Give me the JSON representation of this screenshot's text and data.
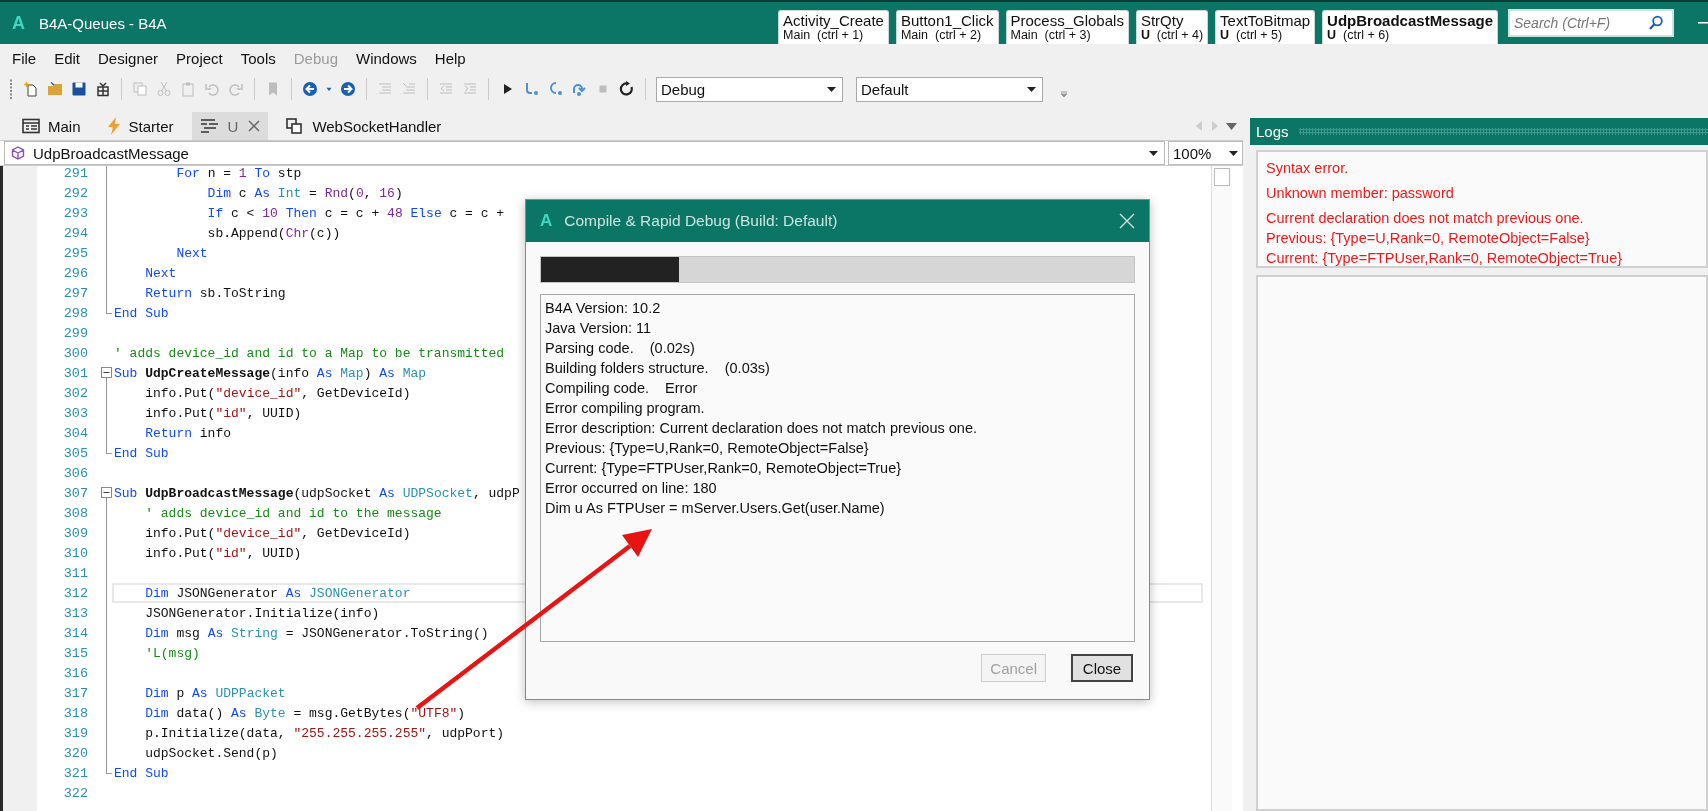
{
  "window": {
    "logo": "A",
    "title": "B4A-Queues - B4A"
  },
  "quick_tabs": [
    {
      "label": "Activity_Create",
      "sub": "Main  (ctrl + 1)",
      "selected": false
    },
    {
      "label": "Button1_Click",
      "sub": "Main  (ctrl + 2)",
      "selected": false
    },
    {
      "label": "Process_Globals",
      "sub": "Main  (ctrl + 3)",
      "selected": false
    },
    {
      "label": "StrQty",
      "sub": "**U**  (ctrl + 4)",
      "selected": false
    },
    {
      "label": "TextToBitmap",
      "sub": "**U**  (ctrl + 5)",
      "selected": false
    },
    {
      "label": "UdpBroadcastMessage",
      "sub": "**U**  (ctrl + 6)",
      "selected": true
    }
  ],
  "search": {
    "placeholder": "Search (Ctrl+F)"
  },
  "menu": [
    {
      "label": "File",
      "disabled": false
    },
    {
      "label": "Edit",
      "disabled": false
    },
    {
      "label": "Designer",
      "disabled": false
    },
    {
      "label": "Project",
      "disabled": false
    },
    {
      "label": "Tools",
      "disabled": false
    },
    {
      "label": "Debug",
      "disabled": true
    },
    {
      "label": "Windows",
      "disabled": false
    },
    {
      "label": "Help",
      "disabled": false
    }
  ],
  "toolbar_groups": [
    [
      {
        "kind": "new",
        "disabled": false
      },
      {
        "kind": "open",
        "disabled": false
      },
      {
        "kind": "save",
        "disabled": false
      },
      {
        "kind": "package",
        "disabled": false
      }
    ],
    [
      {
        "kind": "copy",
        "disabled": true
      },
      {
        "kind": "cut",
        "disabled": true
      },
      {
        "kind": "paste",
        "disabled": true
      },
      {
        "kind": "undo",
        "disabled": true
      },
      {
        "kind": "redo",
        "disabled": true
      }
    ],
    [
      {
        "kind": "bookmark",
        "disabled": true
      }
    ],
    [
      {
        "kind": "back",
        "disabled": false
      },
      {
        "kind": "caret",
        "disabled": false
      },
      {
        "kind": "forward",
        "disabled": false
      }
    ],
    [
      {
        "kind": "comment",
        "disabled": true
      },
      {
        "kind": "uncomment",
        "disabled": true
      }
    ],
    [
      {
        "kind": "outdent",
        "disabled": true
      },
      {
        "kind": "indent",
        "disabled": true
      }
    ],
    [
      {
        "kind": "run",
        "disabled": false
      },
      {
        "kind": "stepin",
        "disabled": false
      },
      {
        "kind": "stepover",
        "disabled": false
      },
      {
        "kind": "stepout",
        "disabled": false
      },
      {
        "kind": "stop",
        "disabled": true
      },
      {
        "kind": "restart",
        "disabled": false
      }
    ]
  ],
  "build_dropdowns": [
    {
      "value": "Debug"
    },
    {
      "value": "Default"
    }
  ],
  "doc_tabs": [
    {
      "label": "Main",
      "kind": "main",
      "selected": false
    },
    {
      "label": "Starter",
      "kind": "starter",
      "selected": false
    },
    {
      "label": "U",
      "kind": "code",
      "selected": true
    },
    {
      "label": "WebSocketHandler",
      "kind": "class",
      "selected": false
    }
  ],
  "editor": {
    "sub_dropdown": "UdpBroadcastMessage",
    "zoom": "100%",
    "lines": [
      {
        "n": "291",
        "kind": "fold-mid",
        "current": false,
        "segments": [
          {
            "text": "        For",
            "kind": "kw"
          },
          {
            "text": " n = ",
            "kind": "plain"
          },
          {
            "text": "1",
            "kind": "num"
          },
          {
            "text": " To",
            "kind": "kw"
          },
          {
            "text": " stp",
            "kind": "plain"
          }
        ]
      },
      {
        "n": "292",
        "kind": "fold-mid",
        "current": false,
        "segments": [
          {
            "text": "            Dim",
            "kind": "kw"
          },
          {
            "text": " c ",
            "kind": "plain"
          },
          {
            "text": "As",
            "kind": "kw"
          },
          {
            "text": " Int",
            "kind": "type"
          },
          {
            "text": " = ",
            "kind": "plain"
          },
          {
            "text": "Rnd",
            "kind": "fn"
          },
          {
            "text": "(",
            "kind": "plain"
          },
          {
            "text": "0",
            "kind": "num"
          },
          {
            "text": ", ",
            "kind": "plain"
          },
          {
            "text": "16",
            "kind": "num"
          },
          {
            "text": ")",
            "kind": "plain"
          }
        ]
      },
      {
        "n": "293",
        "kind": "fold-mid",
        "current": false,
        "segments": [
          {
            "text": "            If",
            "kind": "kw"
          },
          {
            "text": " c < ",
            "kind": "plain"
          },
          {
            "text": "10",
            "kind": "num"
          },
          {
            "text": " Then",
            "kind": "kw"
          },
          {
            "text": " c = c + ",
            "kind": "plain"
          },
          {
            "text": "48",
            "kind": "num"
          },
          {
            "text": " Else",
            "kind": "kw"
          },
          {
            "text": " c = c +",
            "kind": "plain"
          }
        ]
      },
      {
        "n": "294",
        "kind": "fold-mid",
        "current": false,
        "segments": [
          {
            "text": "            sb.Append(",
            "kind": "plain"
          },
          {
            "text": "Chr",
            "kind": "fn"
          },
          {
            "text": "(c))",
            "kind": "plain"
          }
        ]
      },
      {
        "n": "295",
        "kind": "fold-mid",
        "current": false,
        "segments": [
          {
            "text": "        Next",
            "kind": "kw"
          }
        ]
      },
      {
        "n": "296",
        "kind": "fold-mid",
        "current": false,
        "segments": [
          {
            "text": "    Next",
            "kind": "kw"
          }
        ]
      },
      {
        "n": "297",
        "kind": "fold-mid",
        "current": false,
        "segments": [
          {
            "text": "    Return",
            "kind": "kw"
          },
          {
            "text": " sb.ToString",
            "kind": "plain"
          }
        ]
      },
      {
        "n": "298",
        "kind": "fold-end",
        "current": false,
        "segments": [
          {
            "text": "End Sub",
            "kind": "kw"
          }
        ]
      },
      {
        "n": "299",
        "kind": "plain",
        "current": false
      },
      {
        "n": "300",
        "kind": "plain",
        "current": false,
        "segments": [
          {
            "text": "' adds device_id and id to a Map to be transmitted",
            "kind": "com"
          }
        ]
      },
      {
        "n": "301",
        "kind": "fold-start",
        "current": false,
        "segments": [
          {
            "text": "Sub",
            "kind": "kw"
          },
          {
            "text": " UdpCreateMessage",
            "kind": "bold"
          },
          {
            "text": "(info ",
            "kind": "plain"
          },
          {
            "text": "As",
            "kind": "kw"
          },
          {
            "text": " Map",
            "kind": "type"
          },
          {
            "text": ") ",
            "kind": "plain"
          },
          {
            "text": "As",
            "kind": "kw"
          },
          {
            "text": " Map",
            "kind": "type"
          }
        ]
      },
      {
        "n": "302",
        "kind": "fold-mid",
        "current": false,
        "segments": [
          {
            "text": "    info.Put(",
            "kind": "plain"
          },
          {
            "text": "\"device_id\"",
            "kind": "str"
          },
          {
            "text": ", GetDeviceId)",
            "kind": "plain"
          }
        ]
      },
      {
        "n": "303",
        "kind": "fold-mid",
        "current": false,
        "segments": [
          {
            "text": "    info.Put(",
            "kind": "plain"
          },
          {
            "text": "\"id\"",
            "kind": "str"
          },
          {
            "text": ", UUID)",
            "kind": "plain"
          }
        ]
      },
      {
        "n": "304",
        "kind": "fold-mid",
        "current": false,
        "segments": [
          {
            "text": "    Return",
            "kind": "kw"
          },
          {
            "text": " info",
            "kind": "plain"
          }
        ]
      },
      {
        "n": "305",
        "kind": "fold-end",
        "current": false,
        "segments": [
          {
            "text": "End Sub",
            "kind": "kw"
          }
        ]
      },
      {
        "n": "306",
        "kind": "plain",
        "current": false
      },
      {
        "n": "307",
        "kind": "fold-start",
        "current": false,
        "segments": [
          {
            "text": "Sub",
            "kind": "kw"
          },
          {
            "text": " UdpBroadcastMessage",
            "kind": "bold"
          },
          {
            "text": "(udpSocket ",
            "kind": "plain"
          },
          {
            "text": "As",
            "kind": "kw"
          },
          {
            "text": " UDPSocket",
            "kind": "type"
          },
          {
            "text": ", udpP",
            "kind": "plain"
          }
        ]
      },
      {
        "n": "308",
        "kind": "fold-mid",
        "current": false,
        "segments": [
          {
            "text": "    ' adds device_id and id to the message",
            "kind": "com"
          }
        ]
      },
      {
        "n": "309",
        "kind": "fold-mid",
        "current": false,
        "segments": [
          {
            "text": "    info.Put(",
            "kind": "plain"
          },
          {
            "text": "\"device_id\"",
            "kind": "str"
          },
          {
            "text": ", GetDeviceId)",
            "kind": "plain"
          }
        ]
      },
      {
        "n": "310",
        "kind": "fold-mid",
        "current": false,
        "segments": [
          {
            "text": "    info.Put(",
            "kind": "plain"
          },
          {
            "text": "\"id\"",
            "kind": "str"
          },
          {
            "text": ", UUID)",
            "kind": "plain"
          }
        ]
      },
      {
        "n": "311",
        "kind": "fold-mid",
        "current": false
      },
      {
        "n": "312",
        "kind": "fold-mid",
        "current": true,
        "segments": [
          {
            "text": "    Dim",
            "kind": "kw"
          },
          {
            "text": " JSONGenerator ",
            "kind": "plain"
          },
          {
            "text": "As",
            "kind": "kw"
          },
          {
            "text": " JSONGenerator",
            "kind": "type"
          }
        ]
      },
      {
        "n": "313",
        "kind": "fold-mid",
        "current": false,
        "segments": [
          {
            "text": "    JSONGenerator.Initialize(info)",
            "kind": "plain"
          }
        ]
      },
      {
        "n": "314",
        "kind": "fold-mid",
        "current": false,
        "segments": [
          {
            "text": "    Dim",
            "kind": "kw"
          },
          {
            "text": " msg ",
            "kind": "plain"
          },
          {
            "text": "As",
            "kind": "kw"
          },
          {
            "text": " String",
            "kind": "type"
          },
          {
            "text": " = JSONGenerator.ToString()",
            "kind": "plain"
          }
        ]
      },
      {
        "n": "315",
        "kind": "fold-mid",
        "current": false,
        "segments": [
          {
            "text": "    'L(msg)",
            "kind": "com"
          }
        ]
      },
      {
        "n": "316",
        "kind": "fold-mid",
        "current": false
      },
      {
        "n": "317",
        "kind": "fold-mid",
        "current": false,
        "segments": [
          {
            "text": "    Dim",
            "kind": "kw"
          },
          {
            "text": " p ",
            "kind": "plain"
          },
          {
            "text": "As",
            "kind": "kw"
          },
          {
            "text": " UDPPacket",
            "kind": "type"
          }
        ]
      },
      {
        "n": "318",
        "kind": "fold-mid",
        "current": false,
        "segments": [
          {
            "text": "    Dim",
            "kind": "kw"
          },
          {
            "text": " data() ",
            "kind": "plain"
          },
          {
            "text": "As",
            "kind": "kw"
          },
          {
            "text": " Byte",
            "kind": "type"
          },
          {
            "text": " = msg.GetBytes(",
            "kind": "plain"
          },
          {
            "text": "\"UTF8\"",
            "kind": "str"
          },
          {
            "text": ")",
            "kind": "plain"
          }
        ]
      },
      {
        "n": "319",
        "kind": "fold-mid",
        "current": false,
        "segments": [
          {
            "text": "    p.Initialize(data, ",
            "kind": "plain"
          },
          {
            "text": "\"255.255.255.255\"",
            "kind": "str"
          },
          {
            "text": ", udpPort)",
            "kind": "plain"
          }
        ]
      },
      {
        "n": "320",
        "kind": "fold-mid",
        "current": false,
        "segments": [
          {
            "text": "    udpSocket.Send(p)",
            "kind": "plain"
          }
        ]
      },
      {
        "n": "321",
        "kind": "fold-end",
        "current": false,
        "segments": [
          {
            "text": "End Sub",
            "kind": "kw"
          }
        ]
      },
      {
        "n": "322",
        "kind": "plain",
        "current": false
      }
    ]
  },
  "logs": {
    "title": "Logs",
    "entries": [
      "Syntax error.",
      "Unknown member: password",
      "Current declaration does not match previous one.\nPrevious: {Type=U,Rank=0, RemoteObject=False}\nCurrent: {Type=FTPUser,Rank=0, RemoteObject=True}"
    ]
  },
  "dialog": {
    "logo": "A",
    "title": "Compile & Rapid Debug (Build: Default)",
    "level": 0.233,
    "lines": [
      "B4A Version: 10.2",
      "Java Version: 11",
      "Parsing code.    (0.02s)",
      "Building folders structure.    (0.03s)",
      "Compiling code.    Error",
      "Error compiling program.",
      "Error description: Current declaration does not match previous one.",
      "Previous: {Type=U,Rank=0, RemoteObject=False}",
      "Current: {Type=FTPUser,Rank=0, RemoteObject=True}",
      "Error occurred on line: 180",
      "Dim u As FTPUser = mServer.Users.Get(user.Name)"
    ],
    "buttons": [
      {
        "label": "Cancel",
        "disabled": true,
        "focused": false
      },
      {
        "label": "Close",
        "disabled": false,
        "focused": true
      }
    ]
  }
}
